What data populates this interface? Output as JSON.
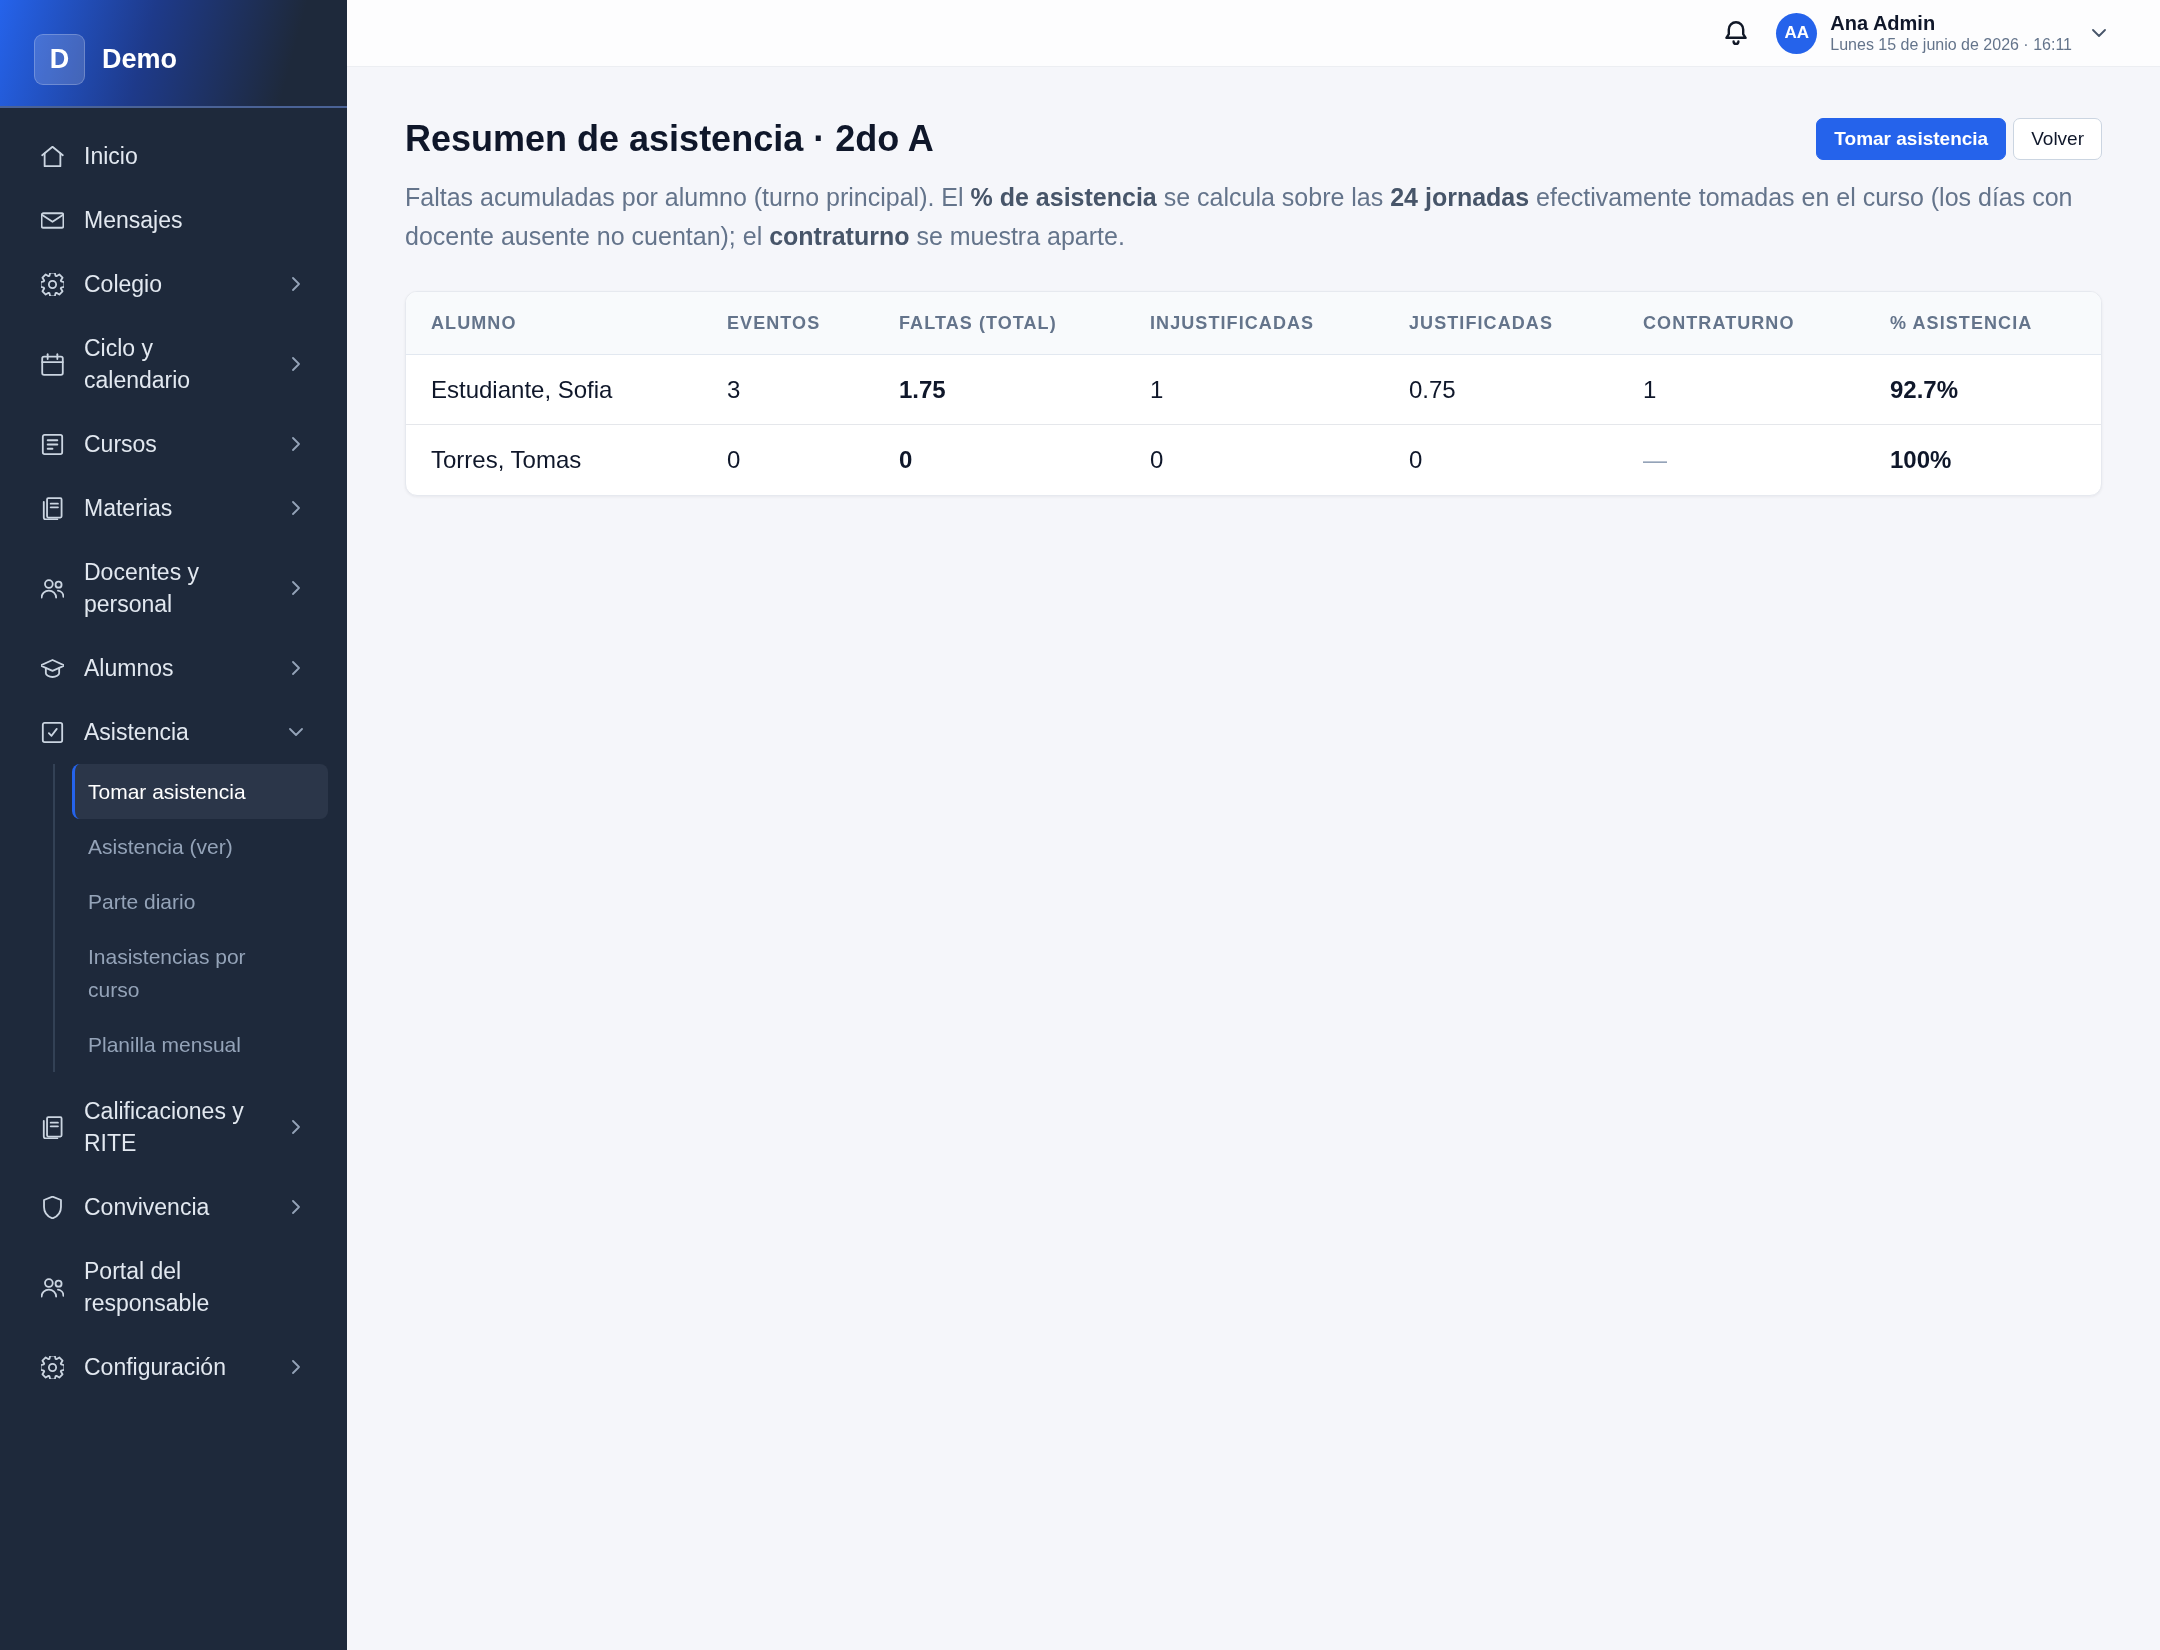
{
  "sidebar": {
    "brand": {
      "initial": "D",
      "name": "Demo"
    },
    "items": [
      {
        "label": "Inicio",
        "kind": "link"
      },
      {
        "label": "Mensajes",
        "kind": "link"
      },
      {
        "label": "Colegio",
        "kind": "group",
        "expanded": false
      },
      {
        "label": "Ciclo y calendario",
        "kind": "group",
        "expanded": false
      },
      {
        "label": "Cursos",
        "kind": "group",
        "expanded": false
      },
      {
        "label": "Materias",
        "kind": "group",
        "expanded": false
      },
      {
        "label": "Docentes y personal",
        "kind": "group",
        "expanded": false
      },
      {
        "label": "Alumnos",
        "kind": "group",
        "expanded": false
      },
      {
        "label": "Asistencia",
        "kind": "group",
        "expanded": true,
        "children": [
          {
            "label": "Tomar asistencia",
            "selected": true
          },
          {
            "label": "Asistencia (ver)",
            "selected": false
          },
          {
            "label": "Parte diario",
            "selected": false
          },
          {
            "label": "Inasistencias por curso",
            "selected": false
          },
          {
            "label": "Planilla mensual",
            "selected": false
          }
        ]
      },
      {
        "label": "Calificaciones y RITE",
        "kind": "group",
        "expanded": false
      },
      {
        "label": "Convivencia",
        "kind": "group",
        "expanded": false
      },
      {
        "label": "Portal del responsable",
        "kind": "link"
      },
      {
        "label": "Configuración",
        "kind": "group",
        "expanded": false
      }
    ]
  },
  "top_bar": {
    "user": {
      "initials": "AA",
      "name": "Ana Admin",
      "date_time": "Lunes 15 de junio de 2026 · 16:11"
    }
  },
  "page": {
    "title": "Resumen de asistencia · 2do A",
    "actions": [
      {
        "label": "Tomar asistencia",
        "kind": "primary"
      },
      {
        "label": "Volver",
        "kind": "secondary"
      }
    ],
    "description": "Faltas acumuladas por alumno (turno principal). El **% de asistencia** se calcula sobre las **24 jornadas** efectivamente tomadas en el curso (los días con docente ausente no cuentan); el **contraturno** se muestra aparte.",
    "table": {
      "columns": [
        "ALUMNO",
        "EVENTOS",
        "FALTAS (TOTAL)",
        "INJUSTIFICADAS",
        "JUSTIFICADAS",
        "CONTRATURNO",
        "% ASISTENCIA"
      ],
      "rows": [
        {
          "cells": [
            {
              "text": "Estudiante, Sofia",
              "muted": false
            },
            {
              "text": "3",
              "muted": false
            },
            {
              "text": "1.75",
              "muted": false
            },
            {
              "text": "1",
              "muted": false
            },
            {
              "text": "0.75",
              "muted": false
            },
            {
              "text": "1",
              "muted": false
            },
            {
              "text": "92.7%",
              "muted": false
            }
          ]
        },
        {
          "cells": [
            {
              "text": "Torres, Tomas",
              "muted": false
            },
            {
              "text": "0",
              "muted": false
            },
            {
              "text": "0",
              "muted": false
            },
            {
              "text": "0",
              "muted": false
            },
            {
              "text": "0",
              "muted": false
            },
            {
              "text": "—",
              "muted": true
            },
            {
              "text": "100%",
              "muted": false
            }
          ]
        }
      ]
    }
  }
}
